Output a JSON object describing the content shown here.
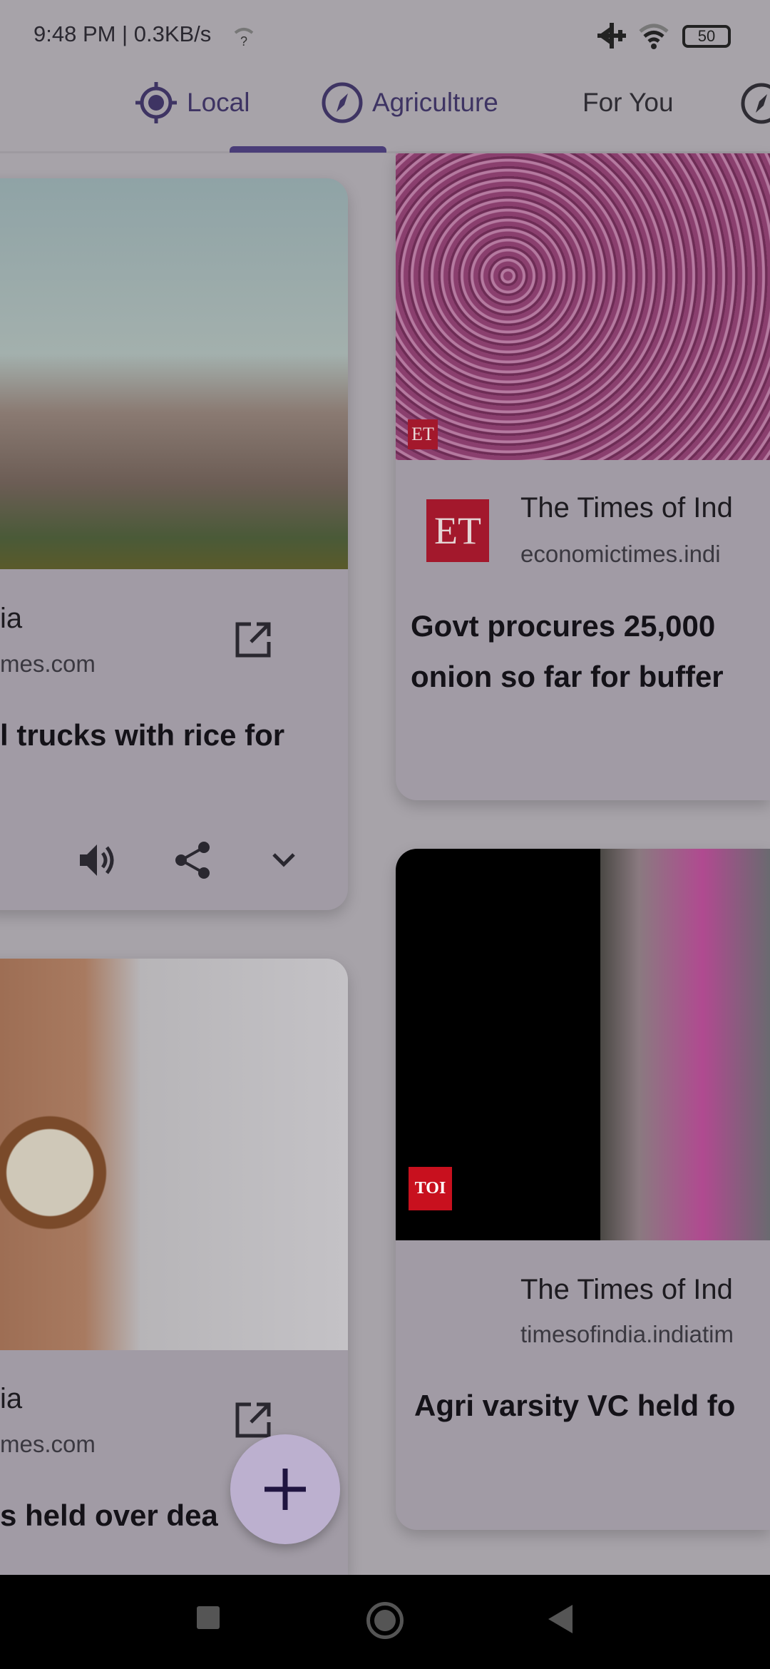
{
  "status_bar": {
    "time_speed": "9:48 PM | 0.3KB/s",
    "battery": "50",
    "icons": [
      "wifi-question-icon",
      "airplane-icon",
      "wifi-icon",
      "battery-icon"
    ]
  },
  "tabs": [
    {
      "label": "Local",
      "icon": "gps-location-icon",
      "selected": false
    },
    {
      "label": "Agriculture",
      "icon": "compass-icon",
      "selected": true
    },
    {
      "label": "For You",
      "selected": false
    }
  ],
  "colors": {
    "accent": "#4a3d78",
    "fab": "#bcb0cf"
  },
  "cards": [
    {
      "source_title": "ia",
      "source_domain": "mes.com",
      "headline": "l trucks with rice for",
      "actions": [
        "speaker-icon",
        "share-icon",
        "chevron-down-icon"
      ]
    },
    {
      "source_title": "ia",
      "source_domain": "mes.com",
      "headline": "s held over dea"
    },
    {
      "logo": "ET",
      "image_badge": "ET",
      "source_title": "The Times of Ind",
      "source_domain": "economictimes.indi",
      "headline_lines": [
        "Govt procures 25,000",
        "onion so far for buffer"
      ]
    },
    {
      "logo": "TOI",
      "source_title": "The Times of Ind",
      "source_domain": "timesofindia.indiatim",
      "headline": "Agri varsity VC held fo"
    }
  ],
  "fab": {
    "icon": "plus-icon"
  },
  "nav": [
    "recents-icon",
    "home-icon",
    "back-icon"
  ]
}
